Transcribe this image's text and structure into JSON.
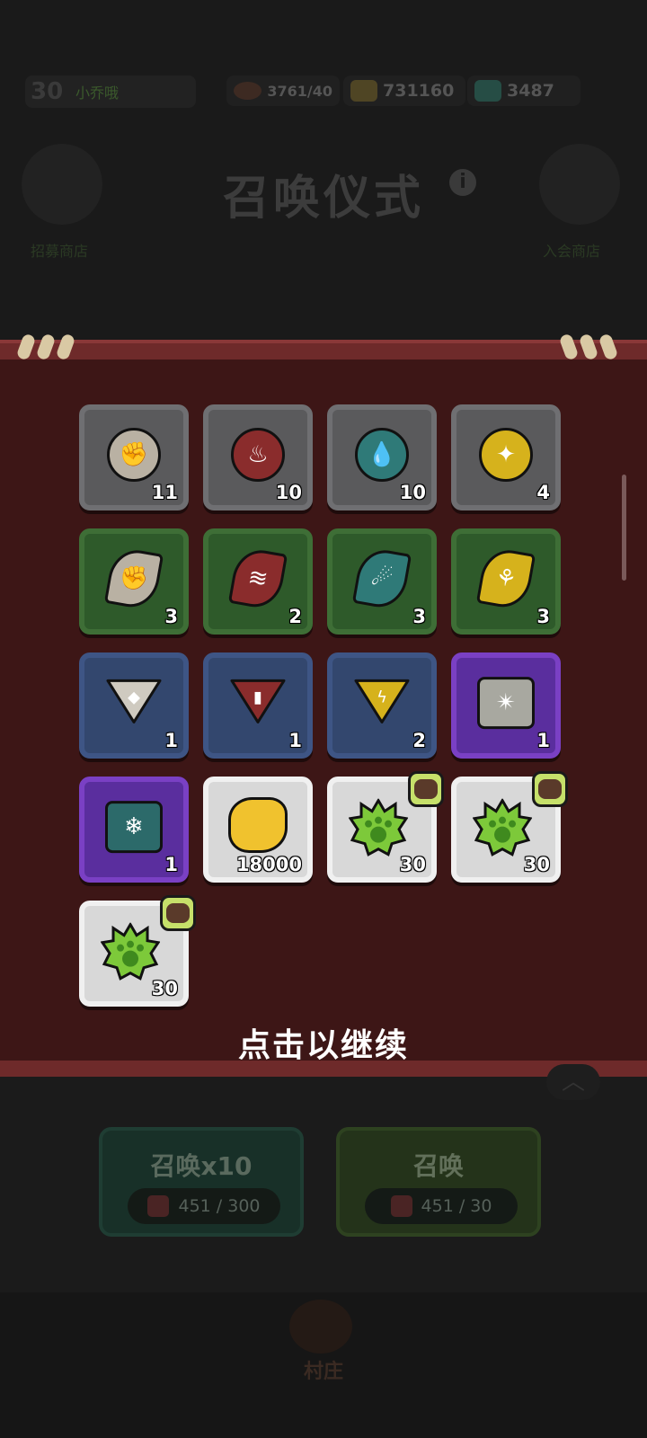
{
  "player": {
    "level": "30",
    "name": "小乔哦"
  },
  "resources": [
    {
      "icon": "meat-icon",
      "value": "3761/40"
    },
    {
      "icon": "gold-ore-icon",
      "value": "731160"
    },
    {
      "icon": "green-gem-icon",
      "value": "3487"
    }
  ],
  "background": {
    "title": "召唤仪式",
    "left_label": "招募商店",
    "right_label": "入会商店"
  },
  "rewards": [
    {
      "color": "gray",
      "shape": "round",
      "icon": "fist-rune-icon",
      "count": "11"
    },
    {
      "color": "gray",
      "shape": "round",
      "icon": "tree-stump-rune-icon",
      "count": "10"
    },
    {
      "color": "gray",
      "shape": "round",
      "icon": "water-drops-rune-icon",
      "count": "10"
    },
    {
      "color": "gray",
      "shape": "round",
      "icon": "sparkle-rune-icon",
      "count": "4"
    },
    {
      "color": "green",
      "shape": "leaf",
      "icon": "fist-halo-rune-icon",
      "count": "3"
    },
    {
      "color": "green",
      "shape": "leaf",
      "icon": "flame-wave-rune-icon",
      "count": "2"
    },
    {
      "color": "green",
      "shape": "leaf",
      "icon": "comet-rune-icon",
      "count": "3"
    },
    {
      "color": "green",
      "shape": "leaf",
      "icon": "plant-rune-icon",
      "count": "3"
    },
    {
      "color": "blue",
      "shape": "tri",
      "icon": "stone-rune-icon",
      "count": "1"
    },
    {
      "color": "blue",
      "shape": "tri",
      "icon": "pillar-rune-icon",
      "count": "1"
    },
    {
      "color": "blue",
      "shape": "tri",
      "icon": "lightning-rune-icon",
      "count": "2"
    },
    {
      "color": "purple",
      "shape": "square",
      "icon": "splash-rune-icon",
      "count": "1"
    },
    {
      "color": "purple",
      "shape": "square",
      "icon": "snowflake-rune-icon",
      "count": "1"
    },
    {
      "color": "white",
      "shape": "gold",
      "icon": "gold-nugget-icon",
      "count": "18000"
    },
    {
      "color": "white",
      "shape": "paw",
      "icon": "green-paw-crystal-icon",
      "count": "30",
      "badge": "mole-portrait-icon"
    },
    {
      "color": "white",
      "shape": "paw",
      "icon": "green-paw-crystal-icon",
      "count": "30",
      "badge": "cat-portrait-icon"
    },
    {
      "color": "white",
      "shape": "paw",
      "icon": "green-paw-crystal-icon",
      "count": "30",
      "badge": "bear-portrait-icon"
    }
  ],
  "continue_text": "点击以继续",
  "buttons": {
    "summon10": {
      "label": "召唤x10",
      "cost": "451 / 300"
    },
    "summon1": {
      "label": "召唤",
      "cost": "451 / 30"
    }
  },
  "nav": {
    "label": "村庄"
  },
  "colors": {
    "gray": "#5a5a5c",
    "green": "#2e5a2a",
    "blue": "#33476e",
    "purple": "#5a2e9e",
    "white": "#d8d8d8",
    "modal_bg": "#3d1616",
    "scroll_edge": "#6e2a2a"
  }
}
